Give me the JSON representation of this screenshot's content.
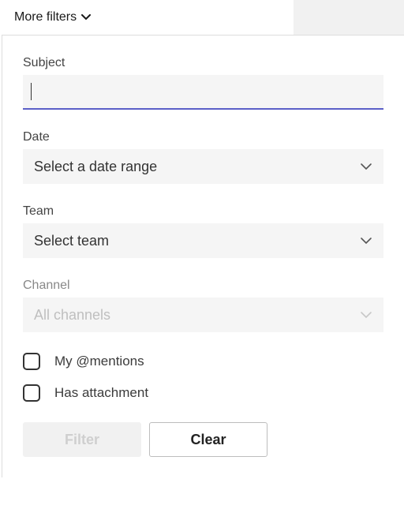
{
  "header": {
    "moreFiltersLabel": "More filters"
  },
  "fields": {
    "subject": {
      "label": "Subject",
      "value": ""
    },
    "date": {
      "label": "Date",
      "placeholder": "Select a date range"
    },
    "team": {
      "label": "Team",
      "placeholder": "Select team"
    },
    "channel": {
      "label": "Channel",
      "placeholder": "All channels",
      "disabled": true
    }
  },
  "checkboxes": {
    "mentions": {
      "label": "My @mentions",
      "checked": false
    },
    "attachment": {
      "label": "Has attachment",
      "checked": false
    }
  },
  "buttons": {
    "filter": "Filter",
    "clear": "Clear"
  }
}
